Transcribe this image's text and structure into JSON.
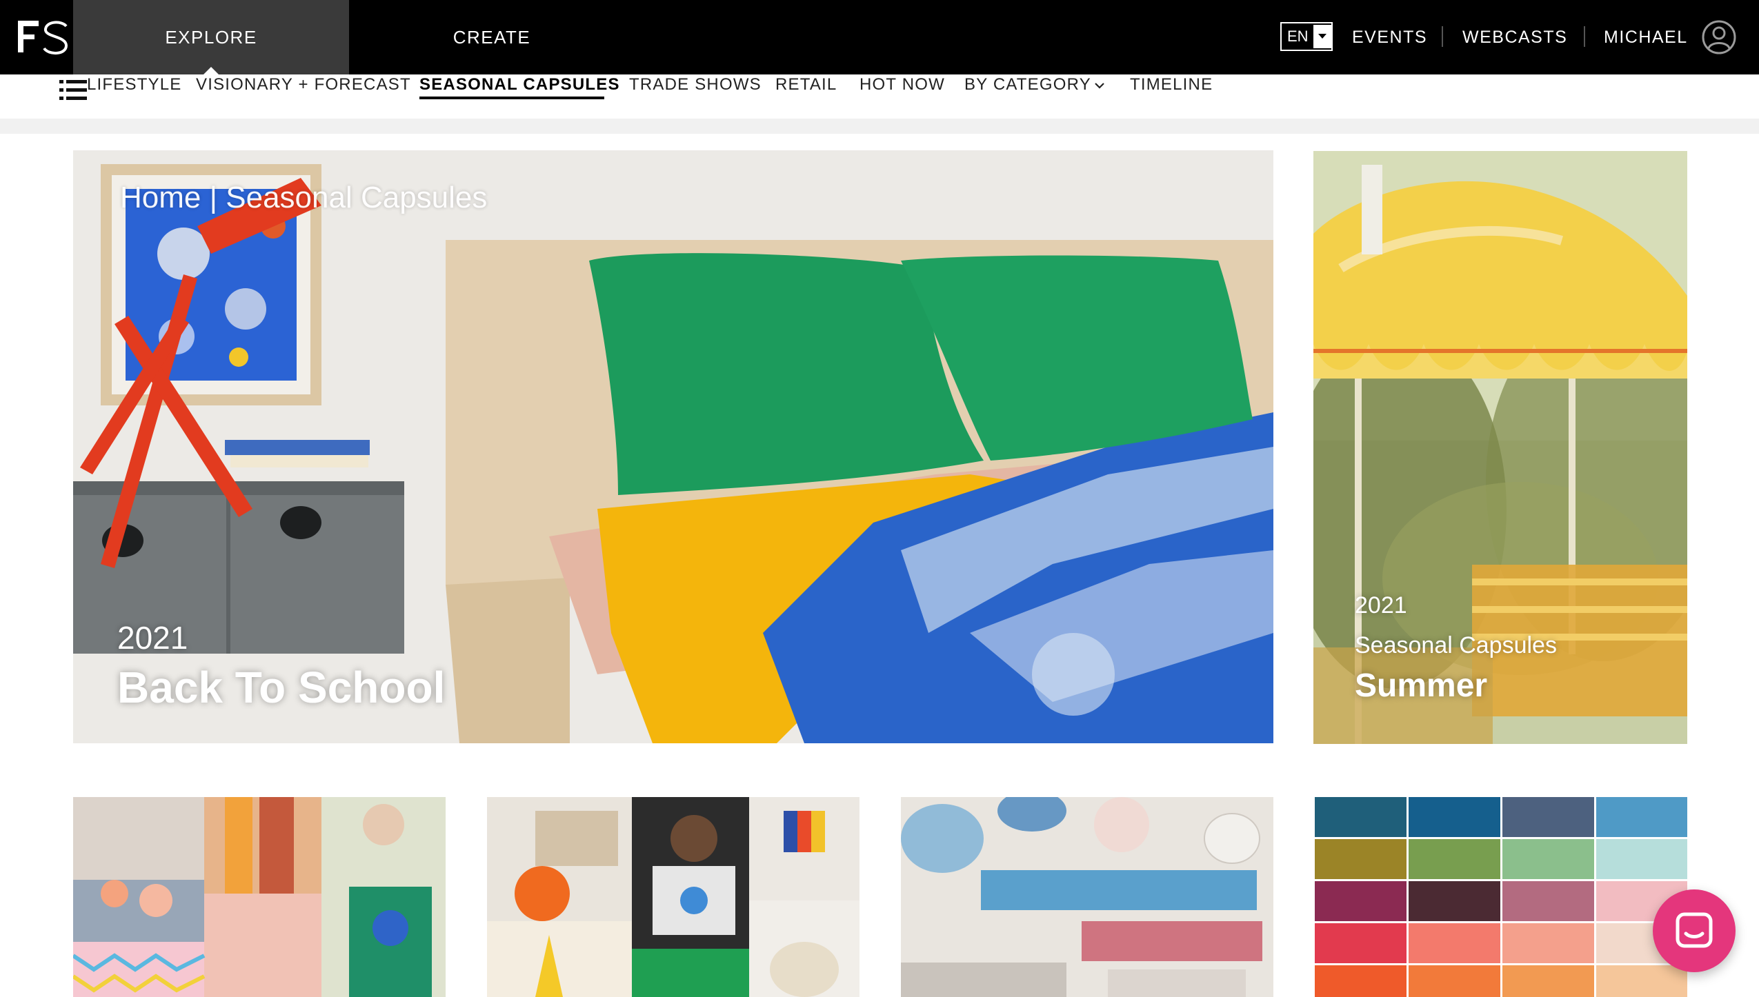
{
  "header": {
    "logo_text": "FS",
    "tabs": [
      {
        "label": "EXPLORE",
        "active": true
      },
      {
        "label": "CREATE",
        "active": false
      }
    ],
    "language": "EN",
    "links": [
      "EVENTS",
      "WEBCASTS"
    ],
    "user_name": "MICHAEL",
    "icons": {
      "avatar": "user-circle-icon",
      "language_dropdown": "caret-down-icon"
    }
  },
  "subnav": {
    "menu_icon": "hamburger-list-icon",
    "items": [
      {
        "label": "LIFESTYLE"
      },
      {
        "label": "VISIONARY + FORECAST"
      },
      {
        "label": "SEASONAL CAPSULES",
        "active": true
      },
      {
        "label": "TRADE SHOWS"
      },
      {
        "label": "RETAIL"
      },
      {
        "label": "HOT NOW"
      },
      {
        "label": "BY CATEGORY",
        "has_dropdown": true
      },
      {
        "label": "TIMELINE"
      }
    ]
  },
  "breadcrumb": "Home | Seasonal Capsules",
  "hero_main": {
    "year": "2021",
    "title": "Back To School"
  },
  "hero_side": {
    "year": "2021",
    "subtitle": "Seasonal Capsules",
    "title": "Summer"
  },
  "cards": [
    {
      "id": "bedroom-collage"
    },
    {
      "id": "youth-collage"
    },
    {
      "id": "tableware-swatches"
    },
    {
      "id": "color-palette"
    }
  ],
  "chat": {
    "icon": "chat-bubble-icon"
  },
  "colors": {
    "topbar_bg": "#000000",
    "explore_tab_bg": "#3a3a3a",
    "chat_pink": "#e4367c"
  }
}
